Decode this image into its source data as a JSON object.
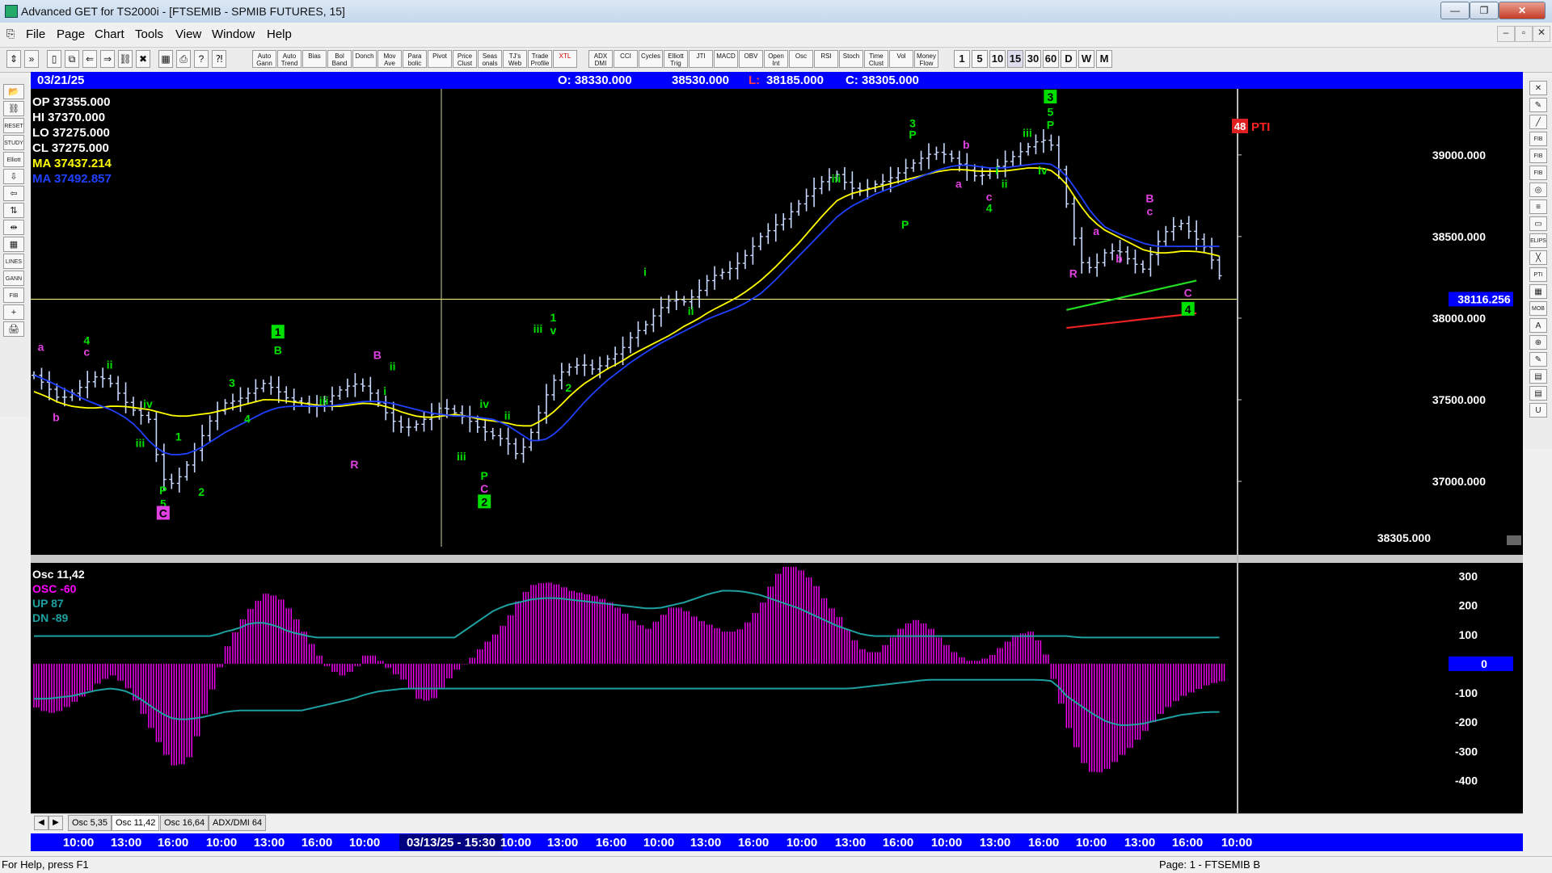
{
  "window": {
    "title": "Advanced GET for TS2000i - [FTSEMIB - SPMIB FUTURES, 15]",
    "min": "—",
    "max": "❐",
    "close": "✕"
  },
  "menu": [
    "File",
    "Page",
    "Chart",
    "Tools",
    "View",
    "Window",
    "Help"
  ],
  "mdi": [
    "–",
    "▫",
    "✕"
  ],
  "toolbar": {
    "studies": [
      "Auto Gann",
      "Auto Trend",
      "Bias",
      "Bol Band",
      "Donch",
      "Mov Ave",
      "Para bolic",
      "Pivot",
      "Price Clust",
      "Seas onals",
      "TJ's Web",
      "Trade Profile",
      "XTL",
      "ADX DMI",
      "CCI",
      "Cycles",
      "Elliott Trig",
      "JTI",
      "MACD",
      "OBV",
      "Open Int",
      "Osc",
      "RSI",
      "Stoch",
      "Time Clust",
      "Vol",
      "Money Flow"
    ],
    "intervals": [
      "1",
      "5",
      "10",
      "15",
      "30",
      "60",
      "D",
      "W",
      "M"
    ],
    "active_interval": "15",
    "icons": [
      "pointer-icon",
      "more-icon",
      "new-page-icon",
      "copy-icon",
      "scroll-left-icon",
      "scroll-right-icon",
      "link-icon",
      "delete-icon",
      "grid-icon",
      "print-icon",
      "help-icon",
      "context-help-icon"
    ]
  },
  "left_tools": [
    "📂",
    "⛓",
    "RESET",
    "STUDY",
    "Elliott",
    "⇩",
    "⇦",
    "⇅",
    "⇹",
    "▦",
    "LINES",
    "GANN",
    "FIB",
    "+",
    "🖨"
  ],
  "right_tools": [
    "✕",
    "✎",
    "╱",
    "FIB RET",
    "FIB EXT",
    "FIB TIME",
    "◎",
    "≡",
    "▭",
    "ELIPS",
    "╳",
    "PTI",
    "▦",
    "MOB",
    "A",
    "⊕",
    "✎",
    "▤",
    "▤",
    "U"
  ],
  "header": {
    "date": "03/21/25",
    "open": "O: 38330.000",
    "high": "38530.000",
    "low_label": "L:",
    "low": "38185.000",
    "close": "C: 38305.000"
  },
  "info_panel": {
    "op": "OP 37355.000",
    "hi": "HI  37370.000",
    "lo": "LO  37275.000",
    "cl": "CL  37275.000",
    "ma1": "MA  37437.214",
    "ma2": "MA  37492.857"
  },
  "osc_panel": {
    "title": "Osc 11,42",
    "osc": "OSC -60",
    "up": "UP  87",
    "dn": "DN  -89"
  },
  "colors": {
    "price_bar": "#c8d8ff",
    "ma_yellow": "#ffff00",
    "ma_blue": "#2040ff",
    "wave_green": "#00e000",
    "wave_magenta": "#e040e0",
    "osc": "#ff00ff",
    "osc_band": "#1ea0a0",
    "red": "#ff2020"
  },
  "chart_data": {
    "type": "line",
    "title": "FTSEMIB - SPMIB FUTURES, 15",
    "price_axis": [
      39000,
      38500,
      38000,
      37500,
      37000
    ],
    "price_axis_labels": [
      "39000.000",
      "38500.000",
      "38000.000",
      "37500.000",
      "37000.000"
    ],
    "ylim": [
      36550,
      39400
    ],
    "cursor_price": 38116.256,
    "cursor_price_label": "38116.256",
    "last_price_label": "38305.000",
    "pti": {
      "value": "48",
      "label": "PTI"
    },
    "price_close": [
      37650,
      37580,
      37500,
      37540,
      37600,
      37650,
      37600,
      37500,
      37420,
      37380,
      37020,
      36980,
      37100,
      37250,
      37400,
      37480,
      37500,
      37550,
      37600,
      37560,
      37500,
      37480,
      37450,
      37500,
      37560,
      37600,
      37580,
      37480,
      37380,
      37320,
      37350,
      37400,
      37460,
      37420,
      37380,
      37320,
      37280,
      37250,
      37150,
      37300,
      37500,
      37650,
      37700,
      37720,
      37680,
      37750,
      37800,
      37900,
      37960,
      38050,
      38120,
      38100,
      38150,
      38250,
      38280,
      38320,
      38400,
      38500,
      38560,
      38620,
      38700,
      38780,
      38850,
      38880,
      38800,
      38780,
      38820,
      38850,
      38900,
      38950,
      39000,
      39020,
      38980,
      38920,
      38860,
      38900,
      38950,
      39000,
      39050,
      39100,
      39050,
      38700,
      38350,
      38300,
      38400,
      38420,
      38350,
      38300,
      38450,
      38550,
      38580,
      38500,
      38420,
      38260
    ],
    "ma_yellow": [
      37550,
      37520,
      37480,
      37460,
      37450,
      37450,
      37460,
      37460,
      37450,
      37440,
      37420,
      37400,
      37400,
      37410,
      37420,
      37440,
      37460,
      37480,
      37500,
      37500,
      37490,
      37480,
      37470,
      37460,
      37460,
      37470,
      37480,
      37470,
      37450,
      37420,
      37400,
      37390,
      37400,
      37410,
      37400,
      37380,
      37370,
      37360,
      37340,
      37340,
      37380,
      37440,
      37520,
      37590,
      37640,
      37690,
      37730,
      37780,
      37820,
      37860,
      37900,
      37950,
      37990,
      38040,
      38080,
      38120,
      38170,
      38230,
      38300,
      38380,
      38460,
      38550,
      38640,
      38720,
      38760,
      38780,
      38800,
      38820,
      38840,
      38860,
      38880,
      38900,
      38910,
      38910,
      38900,
      38900,
      38900,
      38910,
      38920,
      38920,
      38900,
      38820,
      38700,
      38600,
      38540,
      38500,
      38460,
      38420,
      38400,
      38400,
      38410,
      38410,
      38400,
      38380
    ],
    "ma_blue": [
      37650,
      37620,
      37580,
      37540,
      37500,
      37470,
      37440,
      37400,
      37340,
      37250,
      37180,
      37160,
      37170,
      37200,
      37250,
      37300,
      37340,
      37380,
      37420,
      37450,
      37460,
      37460,
      37460,
      37460,
      37470,
      37480,
      37490,
      37490,
      37480,
      37460,
      37440,
      37420,
      37410,
      37400,
      37400,
      37390,
      37380,
      37350,
      37300,
      37250,
      37250,
      37300,
      37380,
      37470,
      37550,
      37620,
      37680,
      37740,
      37790,
      37840,
      37880,
      37920,
      37960,
      38000,
      38030,
      38060,
      38100,
      38150,
      38220,
      38300,
      38380,
      38460,
      38540,
      38620,
      38680,
      38720,
      38760,
      38790,
      38820,
      38850,
      38880,
      38910,
      38930,
      38940,
      38930,
      38920,
      38920,
      38930,
      38940,
      38950,
      38940,
      38870,
      38760,
      38640,
      38560,
      38520,
      38490,
      38460,
      38440,
      38440,
      38440,
      38440,
      38440,
      38440
    ],
    "osc_axis": [
      300,
      200,
      100,
      0,
      -100,
      -200,
      -300,
      -400
    ],
    "osc_axis_labels": [
      "300",
      "200",
      "100",
      "0",
      "-100",
      "-200",
      "-300",
      "-400"
    ],
    "osc_current_label": "0",
    "osc_values": [
      -150,
      -170,
      -160,
      -130,
      -100,
      -60,
      -40,
      -70,
      -140,
      -220,
      -300,
      -360,
      -320,
      -200,
      -60,
      60,
      140,
      200,
      240,
      230,
      180,
      110,
      40,
      -20,
      -40,
      -20,
      40,
      10,
      -30,
      -60,
      -120,
      -130,
      -70,
      -20,
      10,
      60,
      100,
      150,
      230,
      270,
      280,
      270,
      250,
      240,
      230,
      210,
      180,
      140,
      120,
      160,
      200,
      180,
      150,
      130,
      110,
      110,
      150,
      210,
      300,
      340,
      320,
      280,
      210,
      160,
      90,
      40,
      40,
      80,
      130,
      150,
      130,
      80,
      40,
      10,
      10,
      30,
      70,
      100,
      110,
      60,
      -80,
      -220,
      -330,
      -380,
      -360,
      -320,
      -280,
      -230,
      -180,
      -140,
      -110,
      -90,
      -70,
      -60
    ],
    "osc_band_up": [
      95,
      95,
      95,
      95,
      95,
      95,
      95,
      95,
      95,
      95,
      95,
      95,
      95,
      95,
      95,
      110,
      120,
      140,
      140,
      130,
      110,
      100,
      90,
      90,
      90,
      90,
      90,
      90,
      90,
      90,
      90,
      90,
      90,
      90,
      120,
      150,
      180,
      200,
      210,
      220,
      225,
      225,
      220,
      215,
      210,
      205,
      200,
      195,
      190,
      190,
      200,
      210,
      225,
      240,
      250,
      250,
      245,
      235,
      220,
      205,
      190,
      170,
      150,
      130,
      115,
      100,
      95,
      95,
      95,
      95,
      95,
      95,
      95,
      95,
      95,
      95,
      95,
      95,
      95,
      95,
      95,
      95,
      90,
      90,
      90,
      90,
      90,
      90,
      90,
      90,
      90,
      90,
      90,
      90
    ],
    "osc_band_dn": [
      -120,
      -120,
      -115,
      -110,
      -100,
      -90,
      -85,
      -90,
      -110,
      -140,
      -170,
      -190,
      -190,
      -185,
      -175,
      -165,
      -160,
      -160,
      -160,
      -160,
      -160,
      -160,
      -150,
      -140,
      -130,
      -120,
      -105,
      -95,
      -90,
      -85,
      -85,
      -85,
      -85,
      -85,
      -85,
      -85,
      -85,
      -85,
      -85,
      -85,
      -85,
      -85,
      -85,
      -85,
      -85,
      -85,
      -85,
      -85,
      -85,
      -85,
      -85,
      -85,
      -85,
      -85,
      -85,
      -85,
      -85,
      -85,
      -85,
      -85,
      -85,
      -85,
      -85,
      -85,
      -85,
      -80,
      -75,
      -70,
      -65,
      -60,
      -55,
      -55,
      -55,
      -55,
      -55,
      -55,
      -55,
      -55,
      -55,
      -55,
      -60,
      -110,
      -140,
      -170,
      -195,
      -210,
      -210,
      -205,
      -195,
      -185,
      -175,
      -170,
      -165,
      -165
    ],
    "time_labels": [
      "10:00",
      "13:00",
      "16:00",
      "10:00",
      "13:00",
      "16:00",
      "10:00",
      "03/13/25 - 15:30",
      "10:00",
      "13:00",
      "16:00",
      "10:00",
      "13:00",
      "16:00",
      "10:00",
      "13:00",
      "16:00",
      "10:00",
      "13:00",
      "16:00",
      "10:00",
      "13:00",
      "16:00",
      "10:00"
    ],
    "wave_labels": [
      {
        "text": "a",
        "color": "m",
        "i": 1,
        "p": 37800
      },
      {
        "text": "b",
        "color": "m",
        "i": 3,
        "p": 37370
      },
      {
        "text": "4",
        "color": "g",
        "i": 7,
        "p": 37840
      },
      {
        "text": "c",
        "color": "m",
        "i": 7,
        "p": 37770
      },
      {
        "text": "ii",
        "color": "g",
        "i": 10,
        "p": 37690
      },
      {
        "text": "iv",
        "color": "g",
        "i": 15,
        "p": 37450
      },
      {
        "text": "iii",
        "color": "g",
        "i": 14,
        "p": 37210
      },
      {
        "text": "1",
        "color": "g",
        "i": 19,
        "p": 37250
      },
      {
        "text": "P",
        "color": "g",
        "i": 17,
        "p": 36920
      },
      {
        "text": "5",
        "color": "g",
        "i": 17,
        "p": 36840
      },
      {
        "text": "2",
        "color": "g",
        "i": 22,
        "p": 36910
      },
      {
        "text": "3",
        "color": "g",
        "i": 26,
        "p": 37580
      },
      {
        "text": "4",
        "color": "g",
        "i": 28,
        "p": 37360
      },
      {
        "text": "B",
        "color": "g",
        "i": 32,
        "p": 37780
      },
      {
        "text": "iii",
        "color": "g",
        "i": 38,
        "p": 37470
      },
      {
        "text": "B",
        "color": "m",
        "i": 45,
        "p": 37750
      },
      {
        "text": "ii",
        "color": "g",
        "i": 47,
        "p": 37680
      },
      {
        "text": "i",
        "color": "g",
        "i": 46,
        "p": 37530
      },
      {
        "text": "R",
        "color": "m",
        "i": 42,
        "p": 37080
      },
      {
        "text": "iii",
        "color": "g",
        "i": 56,
        "p": 37130
      },
      {
        "text": "iv",
        "color": "g",
        "i": 59,
        "p": 37450
      },
      {
        "text": "ii",
        "color": "g",
        "i": 62,
        "p": 37380
      },
      {
        "text": "P",
        "color": "g",
        "i": 59,
        "p": 37010
      },
      {
        "text": "C",
        "color": "m",
        "i": 59,
        "p": 36930
      },
      {
        "text": "iii",
        "color": "g",
        "i": 66,
        "p": 37910
      },
      {
        "text": "1",
        "color": "g",
        "i": 68,
        "p": 37980
      },
      {
        "text": "v",
        "color": "g",
        "i": 68,
        "p": 37900
      },
      {
        "text": "2",
        "color": "g",
        "i": 70,
        "p": 37550
      },
      {
        "text": "ii",
        "color": "g",
        "i": 86,
        "p": 38020
      },
      {
        "text": "i",
        "color": "g",
        "i": 80,
        "p": 38260
      },
      {
        "text": "iii",
        "color": "g",
        "i": 105,
        "p": 38830
      },
      {
        "text": "P",
        "color": "g",
        "i": 114,
        "p": 38550
      },
      {
        "text": "3",
        "color": "g",
        "i": 115,
        "p": 39170
      },
      {
        "text": "P",
        "color": "g",
        "i": 115,
        "p": 39100
      },
      {
        "text": "b",
        "color": "m",
        "i": 122,
        "p": 39040
      },
      {
        "text": "a",
        "color": "m",
        "i": 121,
        "p": 38800
      },
      {
        "text": "c",
        "color": "m",
        "i": 125,
        "p": 38720
      },
      {
        "text": "4",
        "color": "g",
        "i": 125,
        "p": 38650
      },
      {
        "text": "ii",
        "color": "g",
        "i": 127,
        "p": 38800
      },
      {
        "text": "i",
        "color": "g",
        "i": 126,
        "p": 38880
      },
      {
        "text": "iii",
        "color": "g",
        "i": 130,
        "p": 39110
      },
      {
        "text": "5",
        "color": "g",
        "i": 133,
        "p": 39240
      },
      {
        "text": "P",
        "color": "g",
        "i": 133,
        "p": 39160
      },
      {
        "text": "iv",
        "color": "g",
        "i": 132,
        "p": 38880
      },
      {
        "text": "a",
        "color": "m",
        "i": 139,
        "p": 38510
      },
      {
        "text": "R",
        "color": "m",
        "i": 136,
        "p": 38250
      },
      {
        "text": "b",
        "color": "m",
        "i": 142,
        "p": 38340
      },
      {
        "text": "c",
        "color": "m",
        "i": 146,
        "p": 38630
      },
      {
        "text": "B",
        "color": "m",
        "i": 146,
        "p": 38710
      },
      {
        "text": "C",
        "color": "m",
        "i": 151,
        "p": 38130
      }
    ],
    "wave_boxes": [
      {
        "text": "1",
        "color": "g",
        "i": 32,
        "p": 37890
      },
      {
        "text": "C",
        "color": "m",
        "i": 17,
        "p": 36780
      },
      {
        "text": "2",
        "color": "g",
        "i": 59,
        "p": 36850
      },
      {
        "text": "3",
        "color": "g",
        "i": 133,
        "p": 39330
      },
      {
        "text": "4",
        "color": "g",
        "i": 151,
        "p": 38030
      }
    ]
  }
}
